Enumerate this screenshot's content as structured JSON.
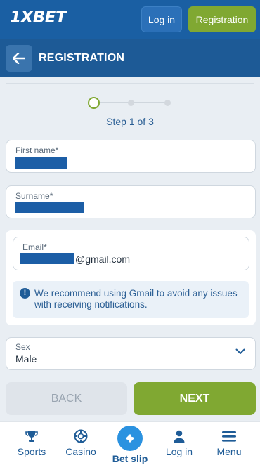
{
  "header": {
    "logo": "1XBET",
    "login_label": "Log in",
    "registration_label": "Registration"
  },
  "titlebar": {
    "title": "REGISTRATION"
  },
  "stepper": {
    "text": "Step 1 of 3",
    "current_step": 1,
    "total_steps": 3
  },
  "form": {
    "first_name_label": "First name*",
    "surname_label": "Surname*",
    "email_label": "Email*",
    "email_suffix": "@gmail.com",
    "notice": "We recommend using Gmail to avoid any issues with receiving notifications.",
    "sex_label": "Sex",
    "sex_value": "Male"
  },
  "actions": {
    "back_label": "BACK",
    "next_label": "NEXT"
  },
  "tabbar": {
    "items": [
      {
        "label": "Sports",
        "icon": "trophy-icon"
      },
      {
        "label": "Casino",
        "icon": "casino-chip-icon"
      },
      {
        "label": "Bet slip",
        "icon": "ticket-icon"
      },
      {
        "label": "Log in",
        "icon": "user-icon"
      },
      {
        "label": "Menu",
        "icon": "hamburger-icon"
      }
    ]
  },
  "colors": {
    "header_bg": "#1a5fa3",
    "accent_green": "#80a832",
    "text_blue": "#2a5e94",
    "redaction": "#1c5ea6"
  }
}
